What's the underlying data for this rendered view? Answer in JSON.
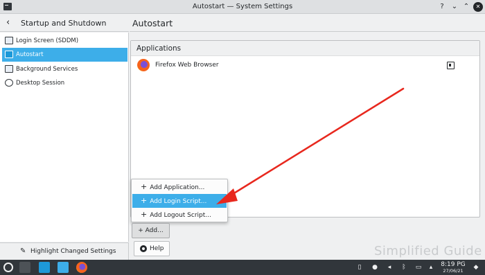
{
  "window": {
    "title": "Autostart — System Settings",
    "help_glyph": "?",
    "minimize_glyph": "⌄",
    "maximize_glyph": "⌃",
    "close_glyph": "✕"
  },
  "sidebar": {
    "back_glyph": "‹",
    "header": "Startup and Shutdown",
    "items": [
      {
        "label": "Login Screen (SDDM)",
        "icon": "monitor-icon"
      },
      {
        "label": "Autostart",
        "icon": "autostart-icon",
        "active": true
      },
      {
        "label": "Background Services",
        "icon": "services-icon"
      },
      {
        "label": "Desktop Session",
        "icon": "session-icon"
      }
    ],
    "footer_label": "Highlight Changed Settings"
  },
  "main": {
    "header": "Autostart",
    "section_title": "Applications",
    "applications": [
      {
        "name": "Firefox Web Browser"
      }
    ],
    "add_button": "+ Add...",
    "help_button": "Help"
  },
  "add_menu": {
    "items": [
      {
        "label": "Add Application...",
        "highlighted": false
      },
      {
        "label": "Add Login Script...",
        "highlighted": true
      },
      {
        "label": "Add Logout Script...",
        "highlighted": false
      }
    ]
  },
  "watermark": "Simplified Guide",
  "taskbar": {
    "time": "8:19 PG",
    "date": "27/06/21"
  },
  "colors": {
    "accent": "#3daee9",
    "annotation_arrow": "#e8281e",
    "taskbar": "#31363b"
  }
}
